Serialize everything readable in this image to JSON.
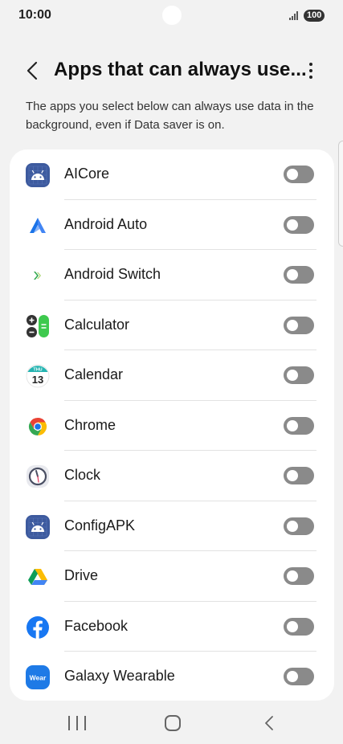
{
  "status_bar": {
    "time": "10:00",
    "battery": "100"
  },
  "header": {
    "title": "Apps that can always use..."
  },
  "description": "The apps you select below can always use data in the background, even if Data saver is on.",
  "apps": [
    {
      "name": "AICore",
      "icon": "android-icon",
      "enabled": false
    },
    {
      "name": "Android Auto",
      "icon": "android-auto-icon",
      "enabled": false
    },
    {
      "name": "Android Switch",
      "icon": "android-switch-icon",
      "enabled": false
    },
    {
      "name": "Calculator",
      "icon": "calculator-icon",
      "enabled": false
    },
    {
      "name": "Calendar",
      "icon": "calendar-icon",
      "enabled": false,
      "icon_text": [
        "THU",
        "13"
      ]
    },
    {
      "name": "Chrome",
      "icon": "chrome-icon",
      "enabled": false
    },
    {
      "name": "Clock",
      "icon": "clock-icon",
      "enabled": false
    },
    {
      "name": "ConfigAPK",
      "icon": "android-icon",
      "enabled": false
    },
    {
      "name": "Drive",
      "icon": "drive-icon",
      "enabled": false
    },
    {
      "name": "Facebook",
      "icon": "facebook-icon",
      "enabled": false
    },
    {
      "name": "Galaxy Wearable",
      "icon": "galaxy-wearable-icon",
      "enabled": false,
      "icon_text": [
        "Wear"
      ]
    }
  ],
  "colors": {
    "background": "#f2f2f2",
    "card": "#ffffff",
    "toggle_off": "#8a8a8a",
    "android_icon_bg": "#3d5a9e",
    "facebook_blue": "#1877f2",
    "wear_blue": "#1e7ae6"
  }
}
